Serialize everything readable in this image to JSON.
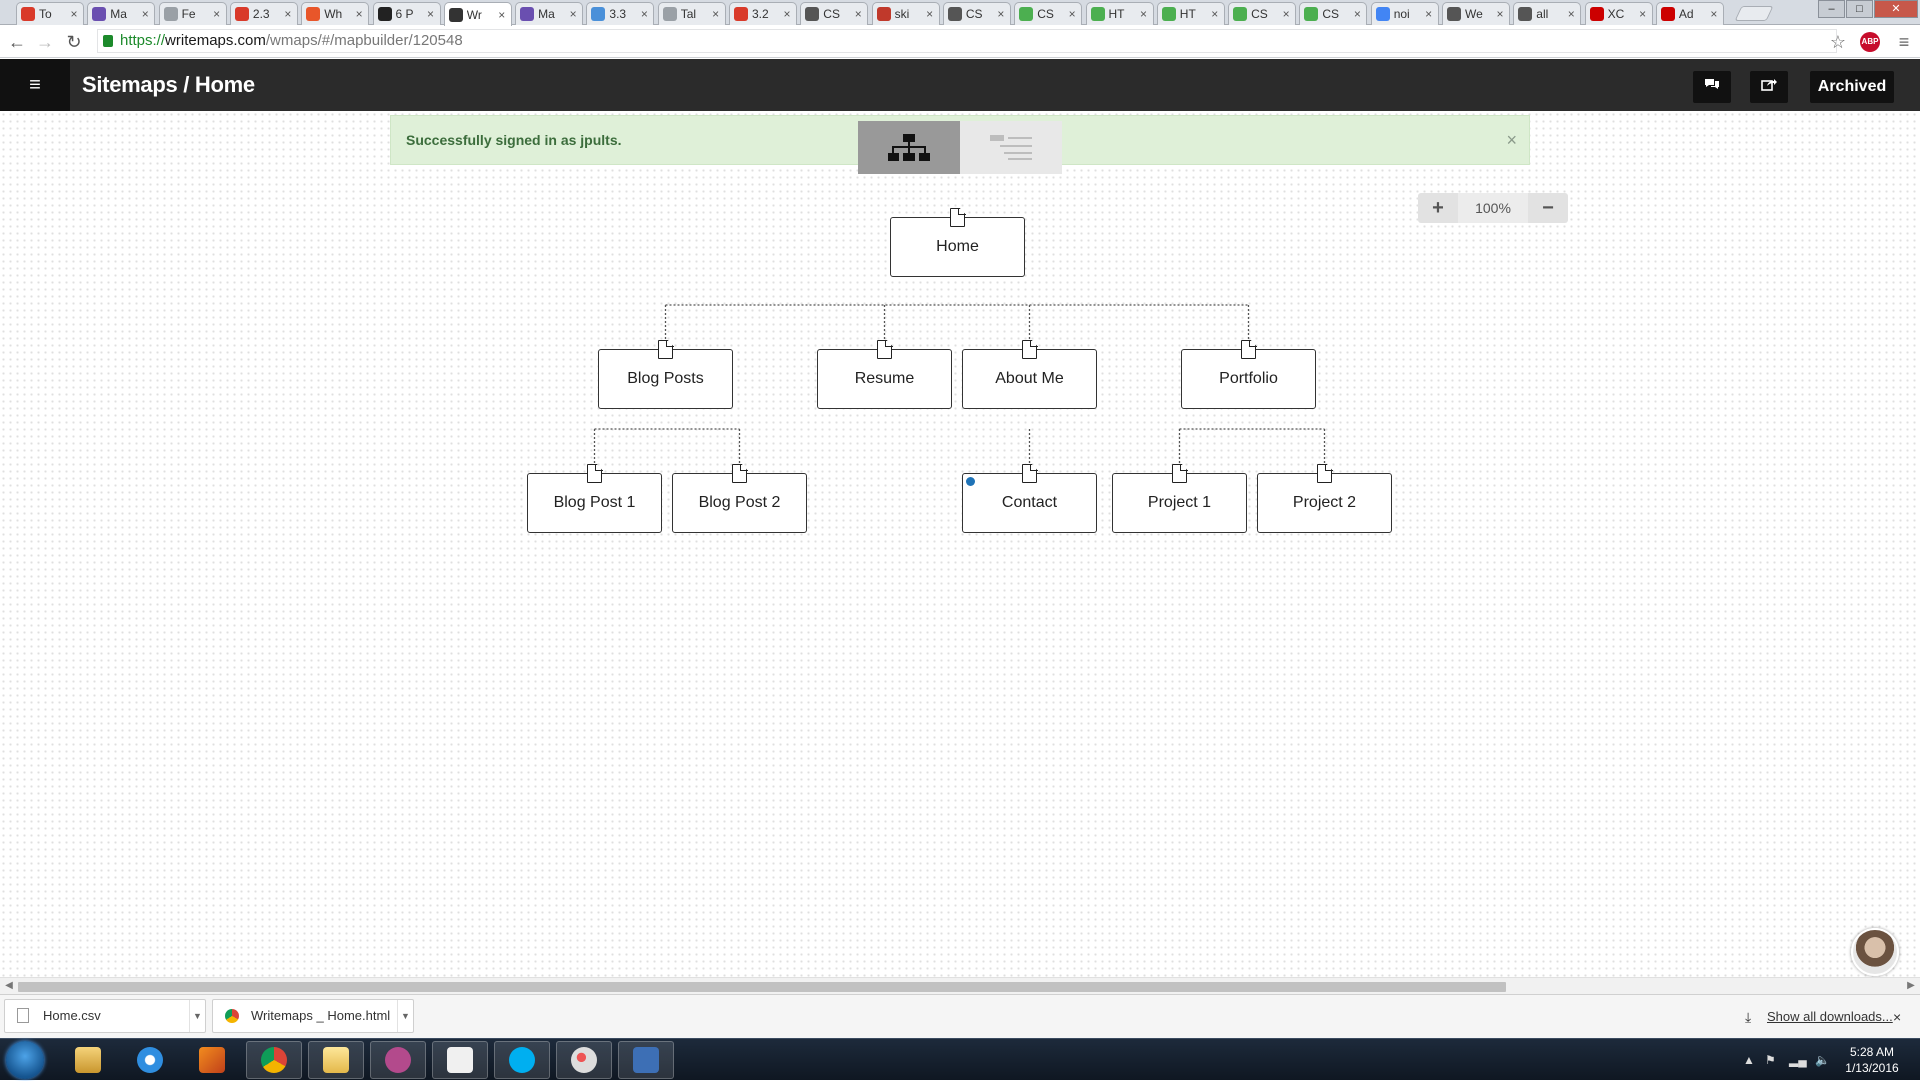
{
  "browser": {
    "tabs": [
      {
        "title": "To",
        "color": "#d93a2a"
      },
      {
        "title": "Ma",
        "color": "#6a4fb0"
      },
      {
        "title": "Fe",
        "color": "#9aa0a6"
      },
      {
        "title": "2.3",
        "color": "#d93a2a"
      },
      {
        "title": "Wh",
        "color": "#e8562a"
      },
      {
        "title": "6 P",
        "color": "#222222"
      },
      {
        "title": "Wr",
        "color": "#333333",
        "active": true
      },
      {
        "title": "Ma",
        "color": "#6a4fb0"
      },
      {
        "title": "3.3",
        "color": "#4a90d9"
      },
      {
        "title": "Tal",
        "color": "#9aa0a6"
      },
      {
        "title": "3.2",
        "color": "#d93a2a"
      },
      {
        "title": "CS",
        "color": "#555555"
      },
      {
        "title": "ski",
        "color": "#c0392b"
      },
      {
        "title": "CS",
        "color": "#555555"
      },
      {
        "title": "CS",
        "color": "#4caf50"
      },
      {
        "title": "HT",
        "color": "#4caf50"
      },
      {
        "title": "HT",
        "color": "#4caf50"
      },
      {
        "title": "CS",
        "color": "#4caf50"
      },
      {
        "title": "CS",
        "color": "#4caf50"
      },
      {
        "title": "noi",
        "color": "#4285f4"
      },
      {
        "title": "We",
        "color": "#555555"
      },
      {
        "title": "all",
        "color": "#555555"
      },
      {
        "title": "XC",
        "color": "#cc0000"
      },
      {
        "title": "Ad",
        "color": "#cc0000"
      }
    ],
    "url_scheme": "https://",
    "url_host": "writemaps.com",
    "url_path": "/wmaps/#/mapbuilder/120548",
    "abp_label": "ABP"
  },
  "app": {
    "title": "Sitemaps / Home",
    "archived_label": "Archived",
    "alert_text": "Successfully signed in as jpults.",
    "alert_close": "×",
    "zoom_in": "+",
    "zoom_value": "100%",
    "zoom_out": "−"
  },
  "sitemap": {
    "nodes": [
      {
        "id": "home",
        "label": "Home",
        "level": 0
      },
      {
        "id": "blog-posts",
        "label": "Blog Posts",
        "level": 1,
        "parent": "home"
      },
      {
        "id": "resume",
        "label": "Resume",
        "level": 1,
        "parent": "home"
      },
      {
        "id": "about-me",
        "label": "About Me",
        "level": 1,
        "parent": "home"
      },
      {
        "id": "portfolio",
        "label": "Portfolio",
        "level": 1,
        "parent": "home"
      },
      {
        "id": "blog-post-1",
        "label": "Blog Post 1",
        "level": 2,
        "parent": "blog-posts"
      },
      {
        "id": "blog-post-2",
        "label": "Blog Post 2",
        "level": 2,
        "parent": "blog-posts"
      },
      {
        "id": "contact",
        "label": "Contact",
        "level": 2,
        "parent": "about-me",
        "marked": true
      },
      {
        "id": "project-1",
        "label": "Project 1",
        "level": 2,
        "parent": "portfolio"
      },
      {
        "id": "project-2",
        "label": "Project 2",
        "level": 2,
        "parent": "portfolio"
      }
    ]
  },
  "downloads": {
    "items": [
      {
        "name": "Home.csv",
        "icon": "file-icon"
      },
      {
        "name": "Writemaps _ Home.html",
        "icon": "chrome-icon"
      }
    ],
    "show_all": "Show all downloads...",
    "close": "×"
  },
  "taskbar": {
    "apps": [
      "file-explorer",
      "internet-explorer",
      "media-player",
      "chrome",
      "folder",
      "goto-meeting",
      "logitech",
      "skype",
      "paint",
      "visual-studio"
    ],
    "time": "5:28 AM",
    "date": "1/13/2016"
  }
}
